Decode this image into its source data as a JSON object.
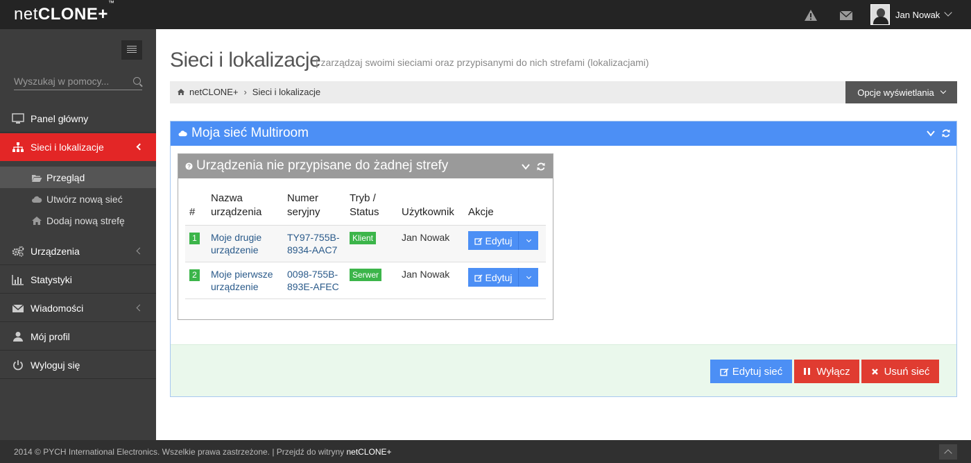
{
  "app": {
    "logo_thin": "net",
    "logo_bold": "CLONE+",
    "logo_tm": "™"
  },
  "topbar": {
    "user_name": "Jan Nowak",
    "icons": [
      "warning-icon",
      "envelope-icon"
    ]
  },
  "sidebar": {
    "search_placeholder": "Wyszukaj w pomocy...",
    "items": [
      {
        "label": "Panel główny",
        "icon": "monitor-icon"
      },
      {
        "label": "Sieci i lokalizacje",
        "icon": "sitemap-icon",
        "active": true
      },
      {
        "label": "Urządzenia",
        "icon": "gears-icon"
      },
      {
        "label": "Statystyki",
        "icon": "bar-chart-icon"
      },
      {
        "label": "Wiadomości",
        "icon": "envelope-icon"
      },
      {
        "label": "Mój profil",
        "icon": "user-icon"
      },
      {
        "label": "Wyloguj się",
        "icon": "power-icon"
      }
    ],
    "subitems": [
      {
        "label": "Przegląd",
        "icon": "folder-open-icon",
        "current": true
      },
      {
        "label": "Utwórz nową sieć",
        "icon": "cloud-icon"
      },
      {
        "label": "Dodaj nową strefę",
        "icon": "home-icon"
      }
    ]
  },
  "main": {
    "title": "Sieci i lokalizacje",
    "subtitle": "| zarządzaj swoimi sieciami oraz przypisanymi do nich strefami (lokalizacjami)",
    "breadcrumb": [
      "netCLONE+",
      "Sieci i lokalizacje"
    ],
    "view_options": "Opcje wyświetlania",
    "portlet": {
      "title": "Moja sieć Multiroom",
      "inner_title": "Urządzenia nie przypisane do żadnej strefy",
      "table": {
        "headers": [
          "#",
          "Nazwa urządzenia",
          "Numer seryjny",
          "Tryb / Status",
          "Użytkownik",
          "Akcje"
        ],
        "rows": [
          {
            "num": "1",
            "name": "Moje drugie urządzenie",
            "serial": "TY97-755B-8934-AAC7",
            "status": "Klient",
            "user": "Jan Nowak",
            "action": "Edytuj"
          },
          {
            "num": "2",
            "name": "Moje pierwsze urządzenie",
            "serial": "0098-755B-893E-AFEC",
            "status": "Serwer",
            "user": "Jan Nowak",
            "action": "Edytuj"
          }
        ]
      },
      "buttons": {
        "edit": "Edytuj sieć",
        "disable": "Wyłącz",
        "delete": "Usuń sieć"
      }
    }
  },
  "footer": {
    "text": "2014 © PYCH International Electronics. Wszelkie prawa zastrzeżone. | Przejdź do witryny",
    "link": "netCLONE+"
  },
  "colors": {
    "accent_red": "#e32626",
    "accent_blue": "#4c8ff5",
    "success_green": "#3cb54a"
  }
}
